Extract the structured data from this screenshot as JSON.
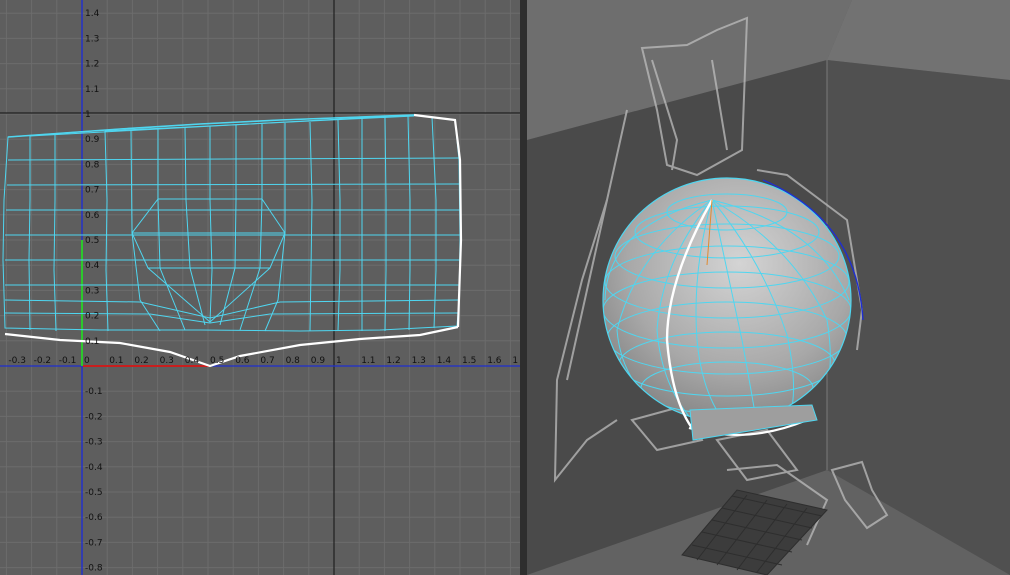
{
  "uv_editor": {
    "y_ticks": [
      "1.4",
      "1.3",
      "1.2",
      "1.1",
      "1",
      "0.9",
      "0.8",
      "0.7",
      "0.6",
      "0.5",
      "0.4",
      "0.3",
      "0.2",
      "0.1",
      "-0.1",
      "-0.2",
      "-0.3",
      "-0.4",
      "-0.5",
      "-0.6",
      "-0.7",
      "-0.8"
    ],
    "x_ticks": [
      "-0.3",
      "-0.2",
      "-0.1",
      "0",
      "0.1",
      "0.2",
      "0.3",
      "0.4",
      "0.5",
      "0.6",
      "0.7",
      "0.8",
      "0.9",
      "1",
      "1.1",
      "1.2",
      "1.3",
      "1.4",
      "1.5",
      "1.6",
      "1"
    ]
  },
  "colors": {
    "uv_background": "#5e5e5e",
    "grid_line": "#6c6c6c",
    "wireframe": "#4fd6f0",
    "border_edge": "#ffffff",
    "v_axis": "#1f2fd0",
    "u_axis": "#c81e1e",
    "viewport_background": "#626262"
  },
  "viewport": {
    "object": "sphere-mesh"
  }
}
